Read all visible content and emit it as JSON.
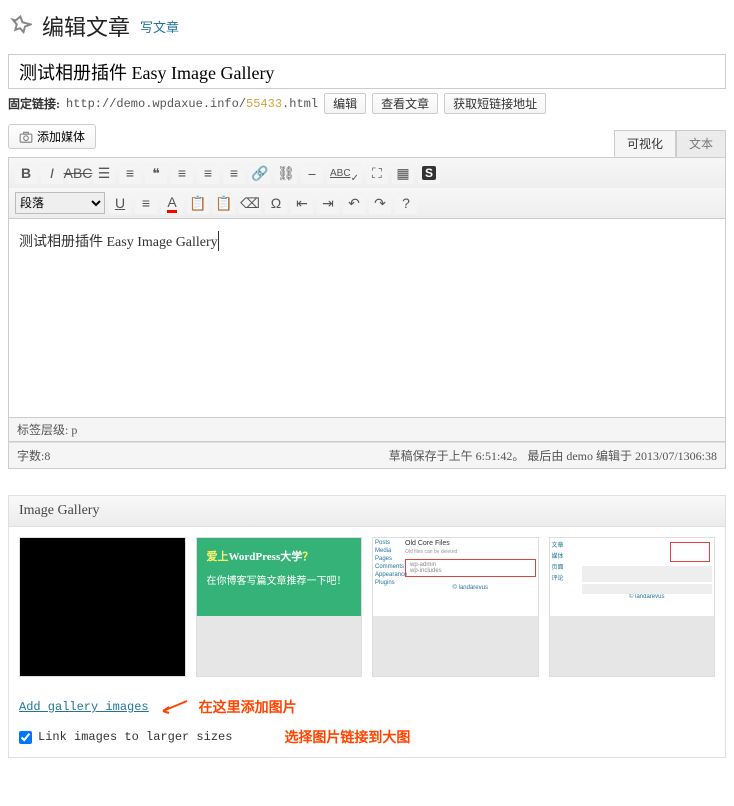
{
  "header": {
    "title": "编辑文章",
    "add_new": "写文章"
  },
  "post": {
    "title": "测试相册插件 Easy Image Gallery",
    "permalink_label": "固定链接:",
    "permalink_base": "http://demo.wpdaxue.info/",
    "permalink_slug": "55433",
    "permalink_ext": ".html",
    "edit_btn": "编辑",
    "view_btn": "查看文章",
    "shortlink_btn": "获取短链接地址"
  },
  "media": {
    "add_media": "添加媒体"
  },
  "tabs": {
    "visual": "可视化",
    "text": "文本"
  },
  "toolbar": {
    "format_select": "段落"
  },
  "editor": {
    "content": "测试相册插件 Easy Image Gallery",
    "path_label": "标签层级:",
    "path_value": "p",
    "word_count_label": "字数:",
    "word_count": "8",
    "autosave": "草稿保存于上午 6:51:42。 最后由 demo 编辑于 2013/07/1306:38"
  },
  "gallery": {
    "metabox_title": "Image Gallery",
    "thumbs": {
      "green_line1_a": "爱上",
      "green_line1_b": "WordPress大学",
      "green_line1_c": "？",
      "green_line2": "在你博客写篇文章推荐一下吧！",
      "ss3_title": "Old Core Files",
      "ss_brand": "landarevus"
    },
    "add_link": "Add gallery images",
    "annotation_add": "在这里添加图片",
    "checkbox_label": "Link images to larger sizes",
    "annotation_link": "选择图片链接到大图"
  }
}
